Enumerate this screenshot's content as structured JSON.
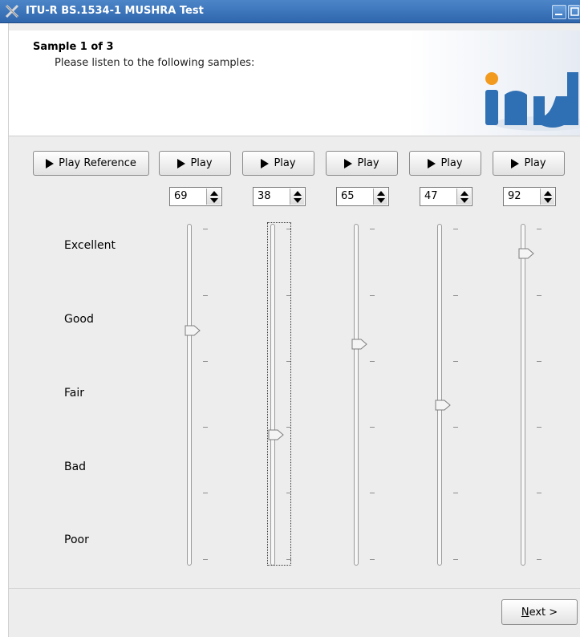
{
  "window": {
    "title": "ITU-R BS.1534-1 MUSHRA Test"
  },
  "header": {
    "sample_title": "Sample 1 of 3",
    "instruction": "Please listen to the following samples:"
  },
  "buttons": {
    "play_reference": "Play Reference",
    "play": "Play",
    "next": "Next >",
    "next_mnemonic": "N",
    "next_rest": "ext >"
  },
  "scores": [
    "69",
    "38",
    "65",
    "47",
    "92"
  ],
  "scale": {
    "min": 0,
    "max": 100,
    "labels": [
      "Excellent",
      "Good",
      "Fair",
      "Bad",
      "Poor"
    ]
  },
  "colors": {
    "titlebar": "#3a72b8",
    "logo_blue": "#2f6fb3",
    "logo_orange": "#f29a1e"
  }
}
